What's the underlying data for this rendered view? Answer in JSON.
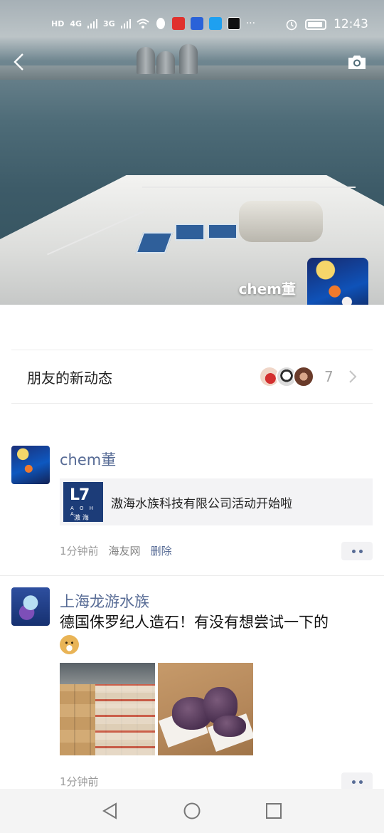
{
  "status_bar": {
    "network_badge": "HD",
    "signal_1": "4G",
    "signal_2": "3G",
    "time": "12:43",
    "icons": [
      "hd-icon",
      "signal-icon",
      "wifi-icon",
      "qq-icon",
      "weibo-icon",
      "baidu-icon",
      "message-icon",
      "capcut-icon",
      "more-icon",
      "alarm-icon",
      "battery-icon"
    ]
  },
  "cover": {
    "username": "chem董"
  },
  "friend_updates": {
    "label": "朋友的新动态",
    "count": "7"
  },
  "posts": [
    {
      "author": "chem董",
      "link_title": "滶海水族科技有限公司活动开始啦",
      "link_logo_en": "A O H A",
      "link_logo_cn": "滶 海",
      "time": "1分钟前",
      "source": "海友网",
      "delete_label": "删除"
    },
    {
      "author": "上海龙游水族",
      "text": "德国侏罗纪人造石！有没有想尝试一下的",
      "emoji": "doge-emoji",
      "time": "1分钟前",
      "images": [
        "photo-warehouse-boxes",
        "photo-rocks-in-box"
      ]
    }
  ]
}
